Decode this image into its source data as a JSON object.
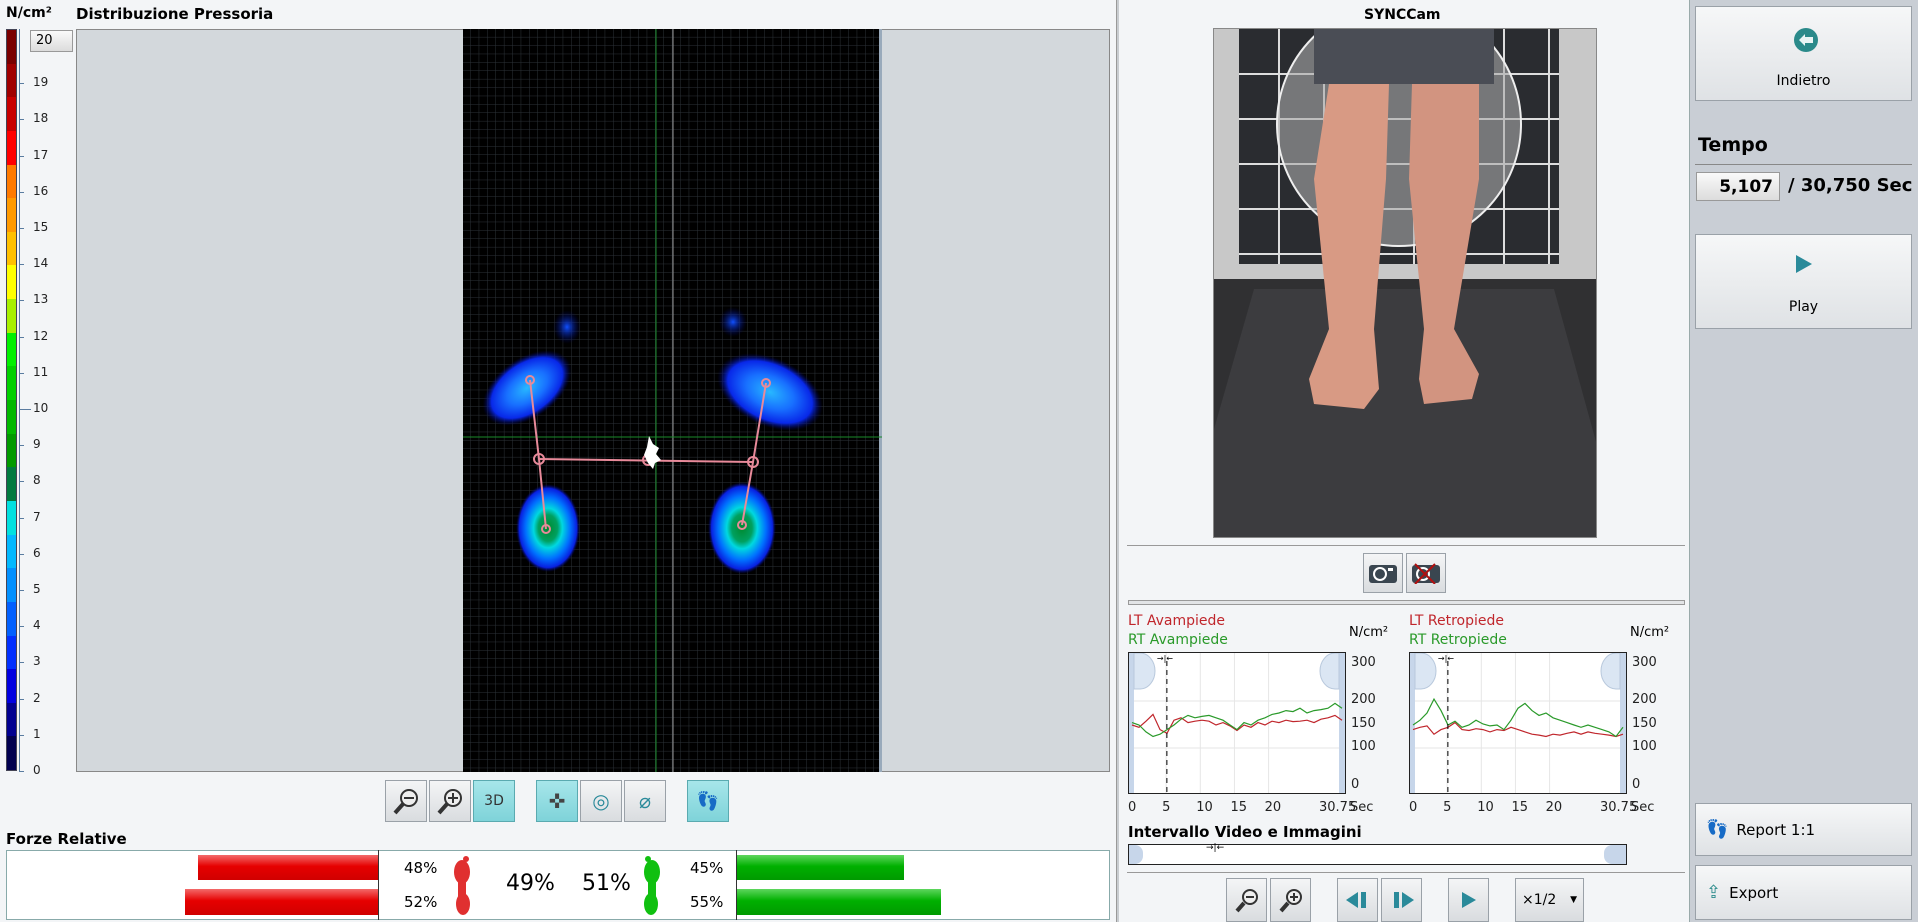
{
  "pressure": {
    "title": "Distribuzione Pressoria",
    "unit": "N/cm²",
    "scale_max_value": "20",
    "scale_ticks": [
      "19",
      "18",
      "17",
      "16",
      "15",
      "14",
      "13",
      "12",
      "11",
      "10",
      "9",
      "8",
      "7",
      "6",
      "5",
      "4",
      "3",
      "2",
      "1",
      "0"
    ],
    "scale_colors": [
      "#7a0000",
      "#a00000",
      "#c80000",
      "#ff0000",
      "#ff7a00",
      "#ff9a00",
      "#ffc000",
      "#ffff00",
      "#a8f000",
      "#00f000",
      "#00d000",
      "#00b800",
      "#009a00",
      "#007a40",
      "#00e0e0",
      "#00b8ff",
      "#0090ff",
      "#0060ff",
      "#0030ff",
      "#0000e0",
      "#000090",
      "#000050"
    ],
    "toolbar": {
      "zoom_out": "zoom-out",
      "zoom_in": "zoom-in",
      "three_d_label": "3D"
    }
  },
  "forces": {
    "title": "Forze Relative",
    "left_fore": "48%",
    "left_rear": "52%",
    "left_total": "49%",
    "right_total": "51%",
    "right_fore": "45%",
    "right_rear": "55%",
    "left_fore_value": 48,
    "left_rear_value": 52,
    "right_fore_value": 45,
    "right_rear_value": 55,
    "left_color": "#e60000",
    "right_color": "#00a000"
  },
  "cam": {
    "title": "SYNCCam"
  },
  "chart_data": [
    {
      "type": "line",
      "title": "Avampiede",
      "legend": [
        "LT Avampiede",
        "RT Avampiede"
      ],
      "ylabel": "N/cm²",
      "xlabel": "Sec",
      "x_ticks": [
        "0",
        "5",
        "10",
        "15",
        "20",
        "30.75"
      ],
      "x_tick_values": [
        0,
        5,
        10,
        15,
        20,
        30.75
      ],
      "y_ticks": [
        "300",
        "200",
        "150",
        "100",
        "0"
      ],
      "y_tick_values": [
        300,
        200,
        150,
        100,
        0
      ],
      "xlim": [
        0,
        30.75
      ],
      "ylim": [
        0,
        300
      ],
      "cursor": 5.107,
      "series": [
        {
          "name": "LT Avampiede",
          "color": "#c0262c",
          "values": [
            150,
            145,
            158,
            172,
            140,
            132,
            160,
            165,
            155,
            158,
            160,
            158,
            150,
            155,
            148,
            138,
            150,
            145,
            155,
            150,
            158,
            155,
            160,
            157,
            158,
            160,
            155,
            162,
            165,
            170,
            160
          ]
        },
        {
          "name": "RT Avampiede",
          "color": "#2a9a2a",
          "values": [
            155,
            150,
            135,
            125,
            130,
            140,
            150,
            162,
            170,
            165,
            168,
            170,
            165,
            160,
            150,
            140,
            155,
            150,
            160,
            165,
            172,
            175,
            180,
            178,
            185,
            175,
            180,
            182,
            185,
            195,
            185
          ]
        }
      ]
    },
    {
      "type": "line",
      "title": "Retropiede",
      "legend": [
        "LT Retropiede",
        "RT Retropiede"
      ],
      "ylabel": "N/cm²",
      "xlabel": "Sec",
      "x_ticks": [
        "0",
        "5",
        "10",
        "15",
        "20",
        "30.75"
      ],
      "x_tick_values": [
        0,
        5,
        10,
        15,
        20,
        30.75
      ],
      "y_ticks": [
        "300",
        "200",
        "150",
        "100",
        "0"
      ],
      "y_tick_values": [
        300,
        200,
        150,
        100,
        0
      ],
      "xlim": [
        0,
        30.75
      ],
      "ylim": [
        0,
        300
      ],
      "cursor": 5.107,
      "series": [
        {
          "name": "LT Retropiede",
          "color": "#c0262c",
          "values": [
            140,
            145,
            148,
            130,
            140,
            145,
            155,
            140,
            138,
            142,
            140,
            135,
            140,
            138,
            145,
            140,
            135,
            130,
            128,
            125,
            130,
            128,
            132,
            135,
            130,
            135,
            132,
            130,
            128,
            125,
            130
          ]
        },
        {
          "name": "RT Retropiede",
          "color": "#2a9a2a",
          "values": [
            150,
            160,
            175,
            205,
            180,
            150,
            158,
            145,
            150,
            160,
            152,
            148,
            150,
            140,
            160,
            185,
            195,
            180,
            170,
            175,
            165,
            160,
            155,
            150,
            145,
            150,
            145,
            140,
            135,
            125,
            145
          ]
        }
      ]
    }
  ],
  "interval": {
    "title": "Intervallo Video e Immagini",
    "speed": "×1/2"
  },
  "side": {
    "back_label": "Indietro",
    "time_title": "Tempo",
    "time_value": "5,107",
    "time_total": "/ 30,750 Sec",
    "play_label": "Play",
    "report_label": "Report 1:1",
    "export_label": "Export"
  }
}
